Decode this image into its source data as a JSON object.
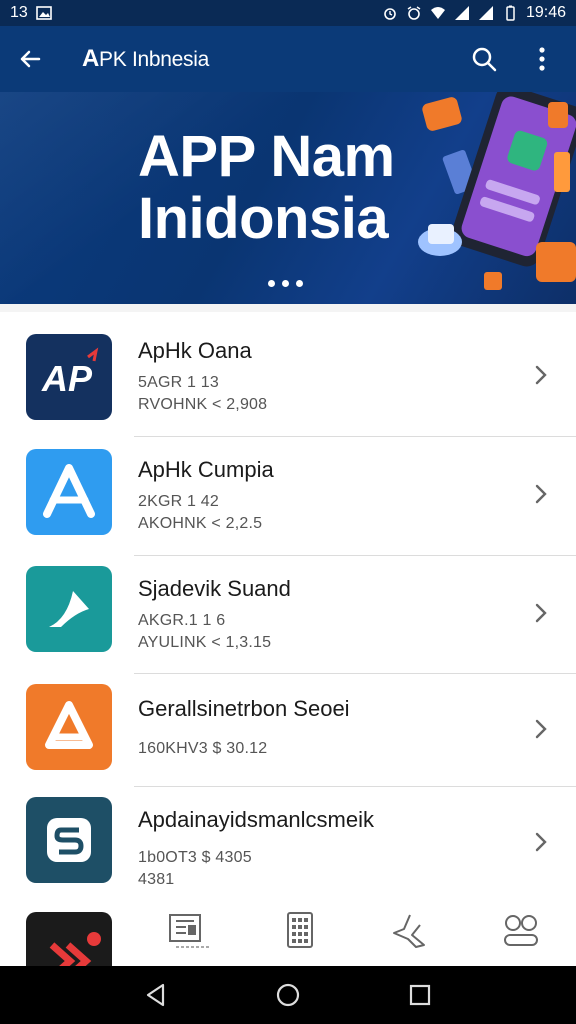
{
  "status_bar": {
    "left_time": "13",
    "right_time": "19:46"
  },
  "app_bar": {
    "title_prefix": "A",
    "title_rest": "PK Inbnesia"
  },
  "banner": {
    "line1": "APP  Nam",
    "line2": "Inidonsia",
    "page_dots": 3
  },
  "apps": [
    {
      "name": "ApHk Oana",
      "meta1": "5AGR 1 13",
      "meta2": "RVOHNK   < 2,908",
      "tile_color": "#14315f"
    },
    {
      "name": "ApHk Cumpia",
      "meta1": "2KGR 1 42",
      "meta2": "AKOHNK   < 2,2.5",
      "tile_color": "#2f9cf0"
    },
    {
      "name": "Sjadevik Suand",
      "meta1": "AKGR.1 1 6",
      "meta2": "AYULINK   < 1,3.15",
      "tile_color": "#1a9a9a"
    },
    {
      "name": "Gerallsinetrbon Seoei",
      "meta1": "160KHV3   $ 30.12",
      "meta2": "",
      "tile_color": "#f07a2a"
    },
    {
      "name": "Apdainayidsmanlcsmeik",
      "meta1": "1b0OT3   $ 4305",
      "meta2": "4381",
      "tile_color": "#1e4f66"
    }
  ],
  "bottom_tabs": [
    "news-icon",
    "calculator-icon",
    "share-icon",
    "profile-icon"
  ],
  "colors": {
    "primary": "#0b3a78",
    "status_bg": "#0a2a55",
    "accent_orange": "#f07a2a"
  }
}
